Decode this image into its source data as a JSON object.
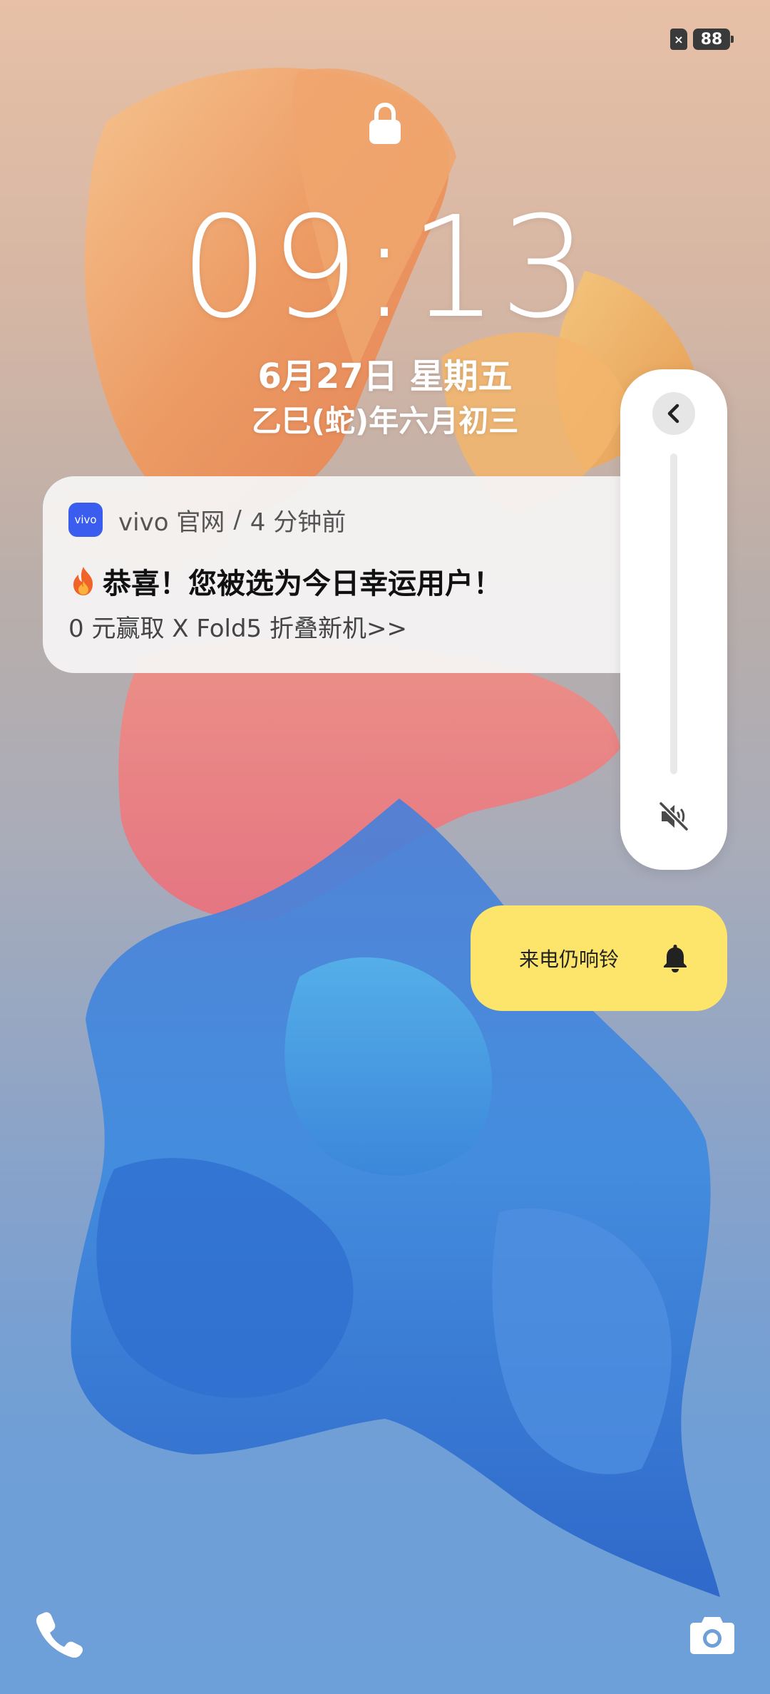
{
  "status_bar": {
    "sim_status": "×",
    "battery_level": "88"
  },
  "lock_screen": {
    "time": "09:13",
    "date": "6月27日 星期五",
    "lunar_date": "乙巳(蛇)年六月初三"
  },
  "notification": {
    "app_icon_text": "vivo",
    "app_name": "vivo 官网",
    "separator": "/",
    "time_ago": "4 分钟前",
    "title": "恭喜！您被选为今日幸运用户！",
    "body": "0 元赢取 X Fold5 折叠新机>>"
  },
  "volume_panel": {
    "level": 0,
    "muted": true
  },
  "ring_toggle": {
    "label": "来电仍响铃"
  },
  "icons": {
    "lock": "lock-icon",
    "fire": "fire-icon",
    "collapse": "chevron-left-icon",
    "mute": "speaker-muted-icon",
    "bell": "bell-icon",
    "phone": "phone-icon",
    "camera": "camera-icon"
  },
  "colors": {
    "ring_card": "#fce56a",
    "app_icon": "#3a5df0"
  }
}
